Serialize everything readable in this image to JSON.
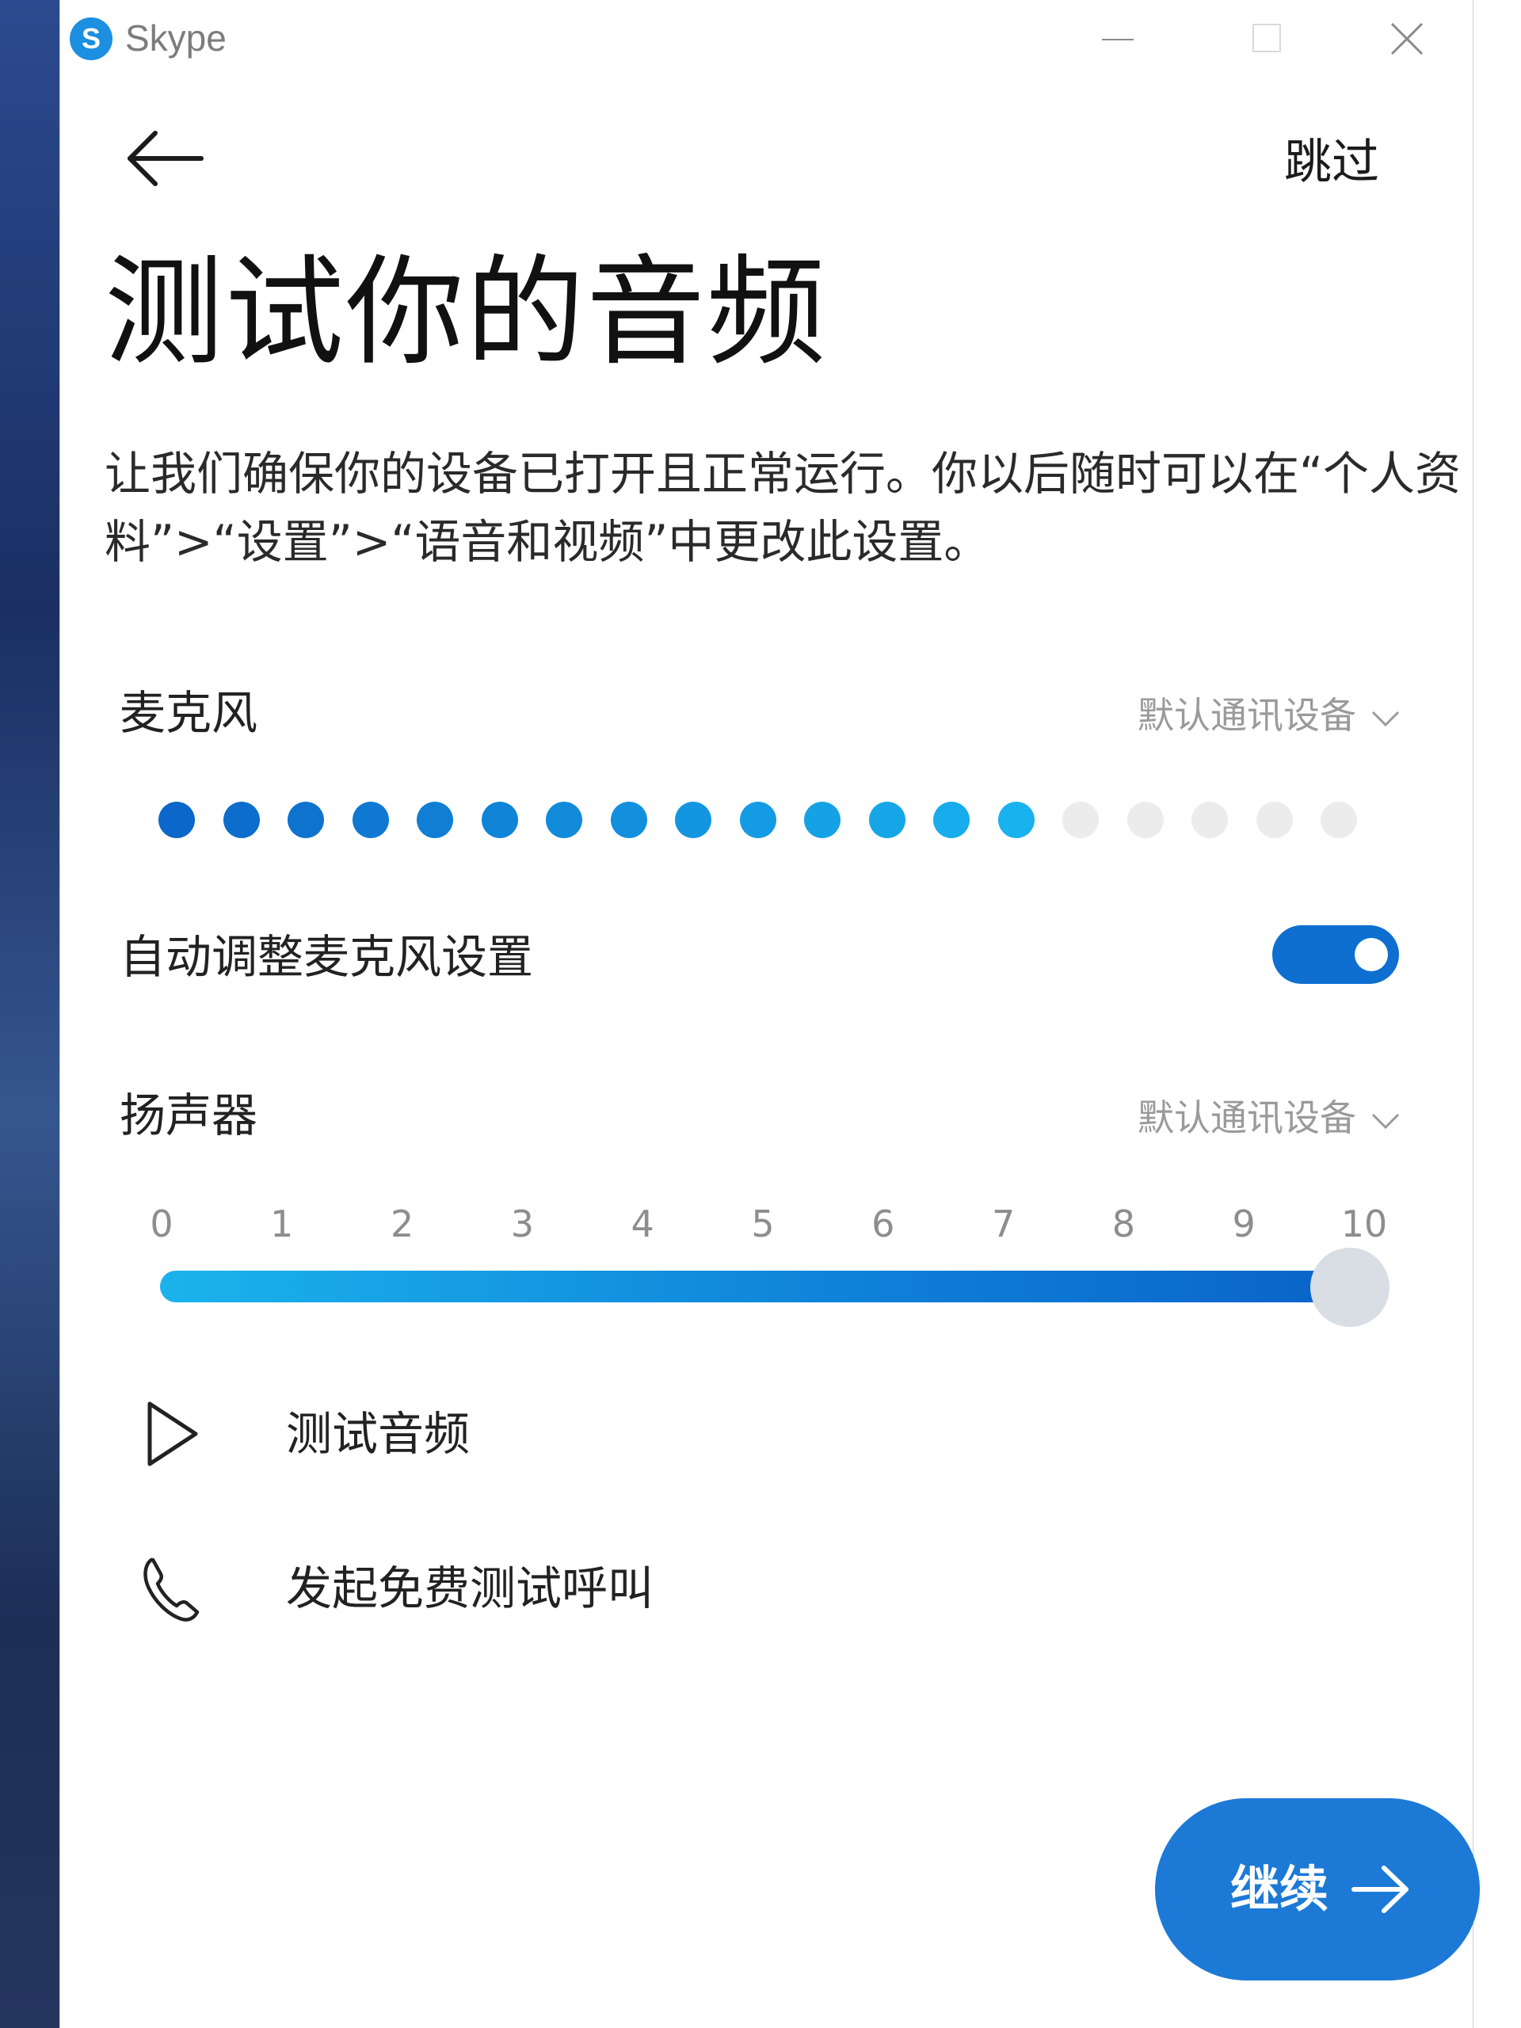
{
  "window": {
    "app_name": "Skype",
    "logo_letter": "S"
  },
  "header": {
    "back_icon": "arrow-left-icon",
    "skip_label": "跳过"
  },
  "page": {
    "title": "测试你的音频",
    "description": "让我们确保你的设备已打开且正常运行。你以后随时可以在“个人资料”>“设置”>“语音和视频”中更改此设置。"
  },
  "microphone": {
    "label": "麦克风",
    "device": "默认通讯设备",
    "level_total": 19,
    "level_active": 14,
    "auto_adjust_label": "自动调整麦克风设置",
    "auto_adjust_on": true
  },
  "speaker": {
    "label": "扬声器",
    "device": "默认通讯设备",
    "scale": [
      "0",
      "1",
      "2",
      "3",
      "4",
      "5",
      "6",
      "7",
      "8",
      "9",
      "10"
    ],
    "volume": 10,
    "volume_max": 10
  },
  "actions": {
    "test_audio": {
      "label": "测试音频",
      "icon": "play-icon"
    },
    "test_call": {
      "label": "发起免费测试呼叫",
      "icon": "phone-icon"
    }
  },
  "footer": {
    "continue_label": "继续",
    "continue_icon": "arrow-right-icon"
  },
  "colors": {
    "accent": "#0e6fd0",
    "dot_active_start": "#0b67c9",
    "dot_active_end": "#18b2ee",
    "dot_inactive": "#ececec",
    "thumb": "#d9dde4"
  }
}
